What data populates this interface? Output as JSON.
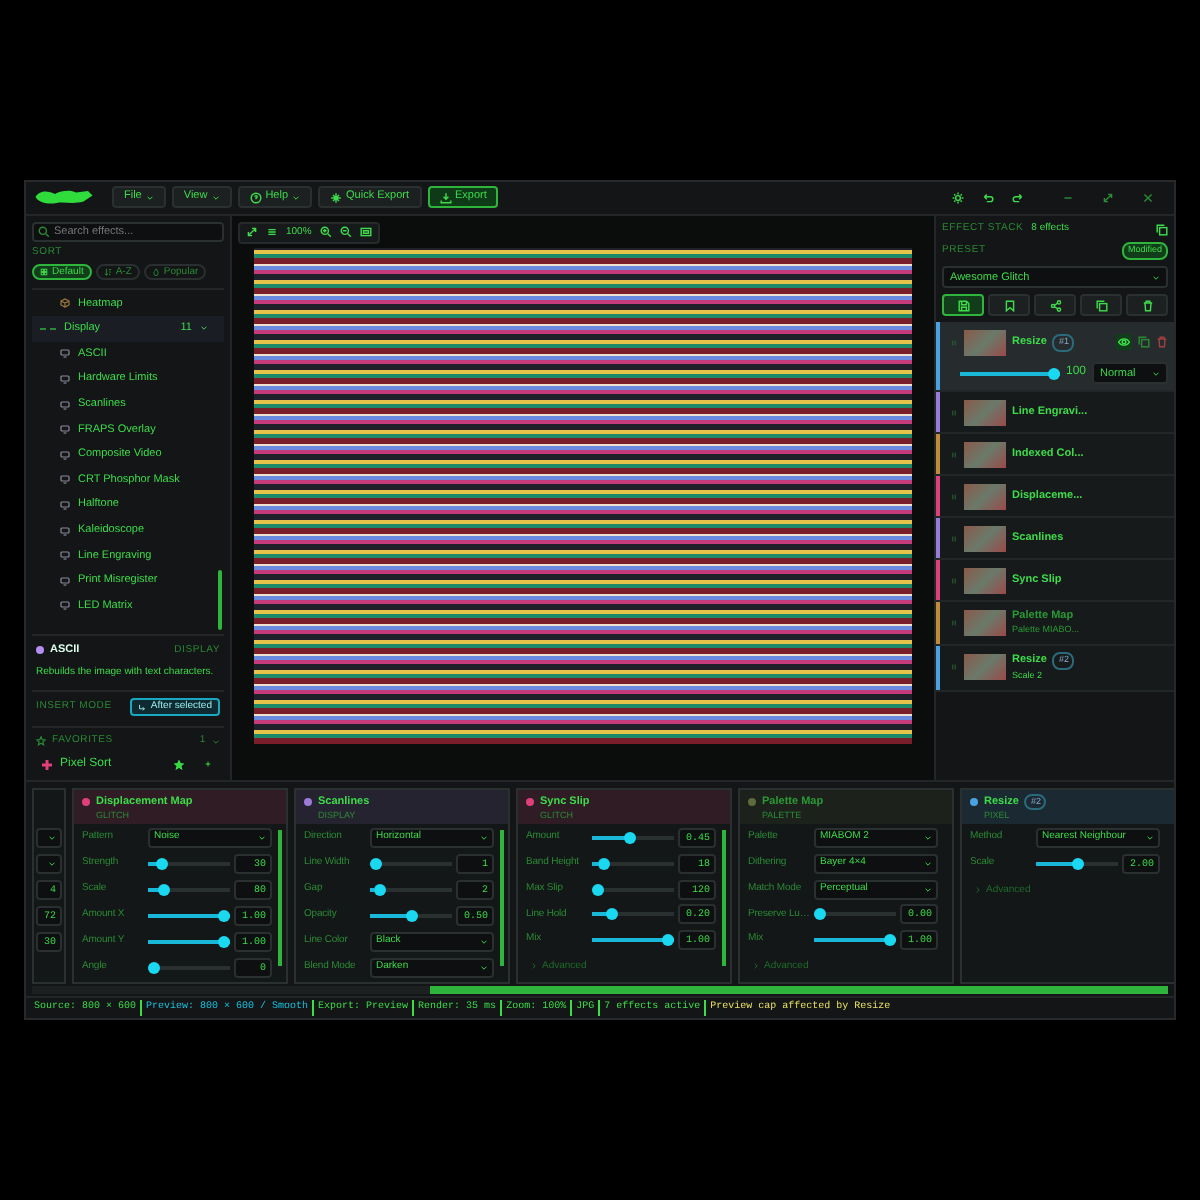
{
  "titlebar": {
    "menus": [
      {
        "label": "File",
        "icon": false
      },
      {
        "label": "View",
        "icon": false
      },
      {
        "label": "Help",
        "icon": true
      }
    ],
    "quick_export": "Quick Export",
    "export": "Export"
  },
  "sidebar": {
    "search_placeholder": "Search effects...",
    "sort_label": "SORT",
    "sort_options": [
      {
        "label": "Default",
        "selected": true
      },
      {
        "label": "A-Z",
        "selected": false
      },
      {
        "label": "Popular",
        "selected": false
      }
    ],
    "tree": [
      {
        "children": [
          {
            "label": "Heatmap"
          }
        ]
      },
      {
        "label": "Display",
        "count": "11",
        "expanded": true,
        "children": [
          {
            "label": "ASCII"
          },
          {
            "label": "Hardware Limits"
          },
          {
            "label": "Scanlines"
          },
          {
            "label": "FRAPS Overlay"
          },
          {
            "label": "Composite Video"
          },
          {
            "label": "CRT Phosphor Mask"
          },
          {
            "label": "Halftone"
          },
          {
            "label": "Kaleidoscope"
          },
          {
            "label": "Line Engraving"
          },
          {
            "label": "Print Misregister"
          },
          {
            "label": "LED Matrix"
          }
        ]
      }
    ],
    "info": {
      "name": "ASCII",
      "category": "DISPLAY",
      "color": "#b48ef0",
      "description": "Rebuilds the image with text characters."
    },
    "insert_mode": {
      "label": "INSERT MODE",
      "value": "After selected"
    },
    "favorites": {
      "label": "FAVORITES",
      "count": "1",
      "expanded": true,
      "items": [
        {
          "label": "Pixel Sort",
          "color": "#e0407a"
        }
      ]
    }
  },
  "canvas": {
    "zoom": "100%"
  },
  "stack": {
    "title": "EFFECT STACK",
    "count": "8 effects",
    "preset_label": "PRESET",
    "preset_status": "Modified",
    "preset": "Awesome Glitch",
    "actions": [
      {
        "selected": true
      },
      {
        "selected": false
      },
      {
        "selected": false
      },
      {
        "selected": false
      },
      {
        "selected": false
      }
    ],
    "items": [
      {
        "name": "Resize",
        "badge": "#1",
        "color": "#4aa3e0",
        "selected": true,
        "enabled": true,
        "opacity": {
          "level": 1,
          "reading": "100"
        },
        "blend": "Normal"
      },
      {
        "name": "Line Engravi...",
        "color": "#9b7bd8",
        "selected": false,
        "enabled": true
      },
      {
        "name": "Indexed Col...",
        "color": "#c08a3a",
        "selected": false,
        "enabled": true
      },
      {
        "name": "Displaceme...",
        "color": "#e0407a",
        "selected": false,
        "enabled": true
      },
      {
        "name": "Scanlines",
        "color": "#9b7bd8",
        "selected": false,
        "enabled": true
      },
      {
        "name": "Sync Slip",
        "color": "#e0407a",
        "selected": false,
        "enabled": true
      },
      {
        "name": "Palette Map",
        "subtitle": "Palette MIABO...",
        "color": "#c08a3a",
        "selected": false,
        "enabled": false
      },
      {
        "name": "Resize",
        "badge": "#2",
        "subtitle": "Scale 2",
        "color": "#4aa3e0",
        "selected": false,
        "enabled": true
      }
    ]
  },
  "panels": [
    {
      "kind": "partial",
      "fields": [
        {
          "kind": "select"
        },
        {
          "kind": "select"
        },
        {
          "kind": "number",
          "value": "4"
        },
        {
          "kind": "number",
          "value": "72"
        },
        {
          "kind": "number",
          "value": "30"
        }
      ]
    },
    {
      "kind": "full",
      "title": "Displacement Map",
      "category": "GLITCH",
      "color": "#e0407a",
      "enabled": true,
      "scrollable": true,
      "fields": [
        {
          "kind": "select",
          "label": "Pattern",
          "value": "Noise"
        },
        {
          "kind": "slider",
          "label": "Strength",
          "level": 0.12,
          "value": "30"
        },
        {
          "kind": "slider",
          "label": "Scale",
          "level": 0.15,
          "value": "80"
        },
        {
          "kind": "slider",
          "label": "Amount X",
          "level": 1,
          "value": "1.00"
        },
        {
          "kind": "slider",
          "label": "Amount Y",
          "level": 1,
          "value": "1.00"
        },
        {
          "kind": "slider",
          "label": "Angle",
          "level": 0,
          "value": "0"
        }
      ]
    },
    {
      "kind": "full",
      "title": "Scanlines",
      "category": "DISPLAY",
      "color": "#9b7bd8",
      "enabled": true,
      "scrollable": true,
      "fields": [
        {
          "kind": "select",
          "label": "Direction",
          "value": "Horizontal"
        },
        {
          "kind": "slider",
          "label": "Line Width",
          "level": 0,
          "value": "1"
        },
        {
          "kind": "slider",
          "label": "Gap",
          "level": 0.05,
          "value": "2"
        },
        {
          "kind": "slider",
          "label": "Opacity",
          "level": 0.5,
          "value": "0.50"
        },
        {
          "kind": "select",
          "label": "Line Color",
          "value": "Black"
        },
        {
          "kind": "select",
          "label": "Blend Mode",
          "value": "Darken"
        }
      ]
    },
    {
      "kind": "full",
      "title": "Sync Slip",
      "category": "GLITCH",
      "color": "#e0407a",
      "enabled": true,
      "scrollable": true,
      "advanced": "Advanced",
      "fields": [
        {
          "kind": "slider",
          "label": "Amount",
          "level": 0.45,
          "value": "0.45"
        },
        {
          "kind": "slider",
          "label": "Band Height",
          "level": 0.08,
          "value": "18"
        },
        {
          "kind": "slider",
          "label": "Max Slip",
          "level": 0,
          "value": "120"
        },
        {
          "kind": "slider",
          "label": "Line Hold",
          "level": 0.2,
          "value": "0.20"
        },
        {
          "kind": "slider",
          "label": "Mix",
          "level": 1,
          "value": "1.00"
        }
      ]
    },
    {
      "kind": "full",
      "title": "Palette Map",
      "category": "PALETTE",
      "color": "#5c6a3c",
      "enabled": false,
      "scrollable": false,
      "advanced": "Advanced",
      "fields": [
        {
          "kind": "select",
          "label": "Palette",
          "value": "MIABOM 2"
        },
        {
          "kind": "select",
          "label": "Dithering",
          "value": "Bayer 4×4"
        },
        {
          "kind": "select",
          "label": "Match Mode",
          "value": "Perceptual"
        },
        {
          "kind": "slider",
          "label": "Preserve Lu…",
          "level": 0,
          "value": "0.00"
        },
        {
          "kind": "slider",
          "label": "Mix",
          "level": 1,
          "value": "1.00"
        }
      ]
    },
    {
      "kind": "full",
      "title": "Resize",
      "badge": "#2",
      "category": "PIXEL",
      "color": "#4aa3e0",
      "enabled": true,
      "scrollable": false,
      "advanced": "Advanced",
      "fields": [
        {
          "kind": "select",
          "label": "Method",
          "value": "Nearest Neighbour"
        },
        {
          "kind": "slider",
          "label": "Scale",
          "level": 0.5,
          "value": "2.00"
        }
      ]
    }
  ],
  "status_bar": [
    {
      "text": "Source: 800 × 600",
      "kind": "plain"
    },
    {
      "text": "Preview: 800 × 600 / Smooth",
      "kind": "accent"
    },
    {
      "text": "Export: Preview",
      "kind": "plain"
    },
    {
      "text": "Render: 35 ms",
      "kind": "plain"
    },
    {
      "text": "Zoom: 100%",
      "kind": "plain"
    },
    {
      "text": "JPG",
      "kind": "plain"
    },
    {
      "text": "7 effects active",
      "kind": "plain"
    },
    {
      "text": "Preview cap affected by Resize",
      "kind": "warning"
    }
  ]
}
